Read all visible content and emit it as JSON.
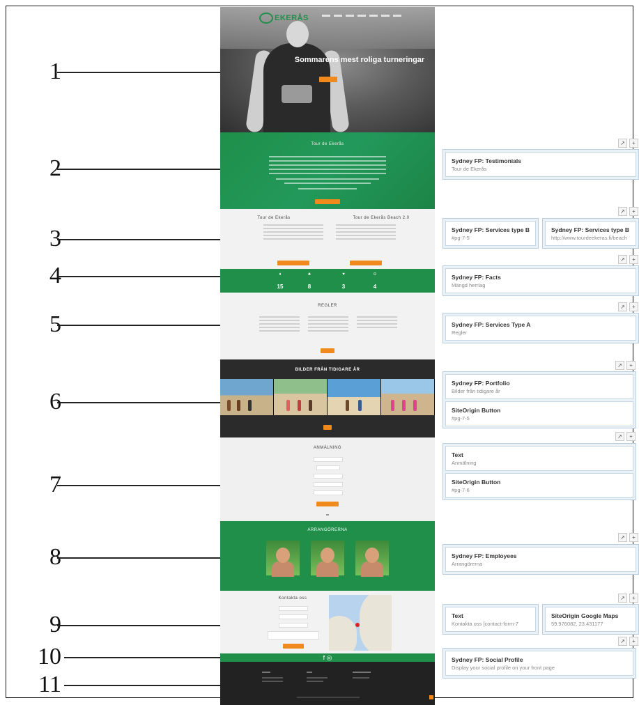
{
  "callouts": [
    "1",
    "2",
    "3",
    "4",
    "5",
    "6",
    "7",
    "8",
    "9",
    "10",
    "11"
  ],
  "site": {
    "logo": "EKERÅS",
    "hero_title": "Sommarens mest roliga turneringar",
    "s2_title": "Tour de Ekerås",
    "s3_col1_title": "Tour de Ekerås",
    "s3_col2_title": "Tour de Ekerås Beach 2.0",
    "facts": [
      {
        "icon": "♦",
        "value": "15"
      },
      {
        "icon": "♣",
        "value": "8"
      },
      {
        "icon": "♥",
        "value": "3"
      },
      {
        "icon": "⊙",
        "value": "4"
      }
    ],
    "s5_title": "REGLER",
    "s6_title": "BILDER FRÅN TIDIGARE ÅR",
    "s7_title": "ANMÄLNING",
    "s8_title": "ARRANGÖRERNA",
    "s9_title": "Kontakta oss",
    "social_icons": "f  ◎"
  },
  "panel": {
    "row2": {
      "title": "Sydney FP: Testimonials",
      "sub": "Tour de Ekerås"
    },
    "row3a": {
      "title": "Sydney FP: Services type B",
      "sub": "#pg-7-5"
    },
    "row3b": {
      "title": "Sydney FP: Services type B",
      "sub": "http://www.tourdeekeras.fi/beach"
    },
    "row4": {
      "title": "Sydney FP: Facts",
      "sub": "Mängd herrlag"
    },
    "row5": {
      "title": "Sydney FP: Services Type A",
      "sub": "Regler"
    },
    "row6a": {
      "title": "Sydney FP: Portfolio",
      "sub": "Bilder från tidigare år"
    },
    "row6b": {
      "title": "SiteOrigin Button",
      "sub": "#pg-7-5"
    },
    "row7a": {
      "title": "Text",
      "sub": "Anmälning"
    },
    "row7b": {
      "title": "SiteOrigin Button",
      "sub": "#pg-7-6"
    },
    "row8": {
      "title": "Sydney FP: Employees",
      "sub": "Arrangörerna"
    },
    "row9a": {
      "title": "Text",
      "sub": "Kontakta oss [contact-form-7"
    },
    "row9b": {
      "title": "SiteOrigin Google Maps",
      "sub": "59.976082, 23.431177"
    },
    "row10": {
      "title": "Sydney FP: Social Profile",
      "sub": "Display your social profile on your front page"
    },
    "tool_edit": "↗",
    "tool_add": "+"
  }
}
